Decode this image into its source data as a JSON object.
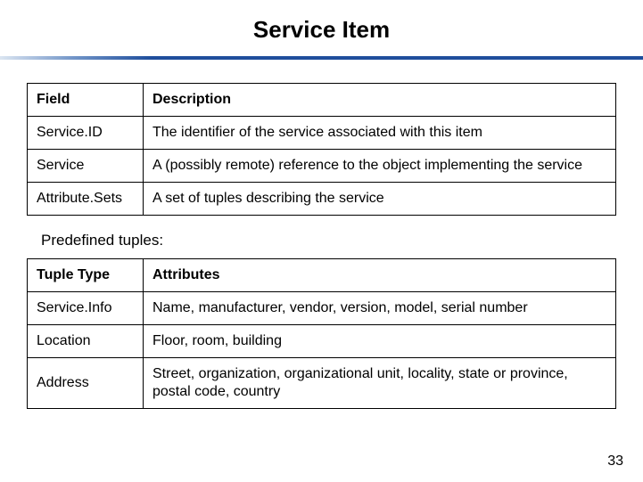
{
  "title": "Service Item",
  "fields_table": {
    "headers": {
      "c1": "Field",
      "c2": "Description"
    },
    "rows": [
      {
        "c1": "Service.ID",
        "c2": "The identifier of the service associated with this item"
      },
      {
        "c1": "Service",
        "c2": "A (possibly remote) reference to the object implementing the service"
      },
      {
        "c1": "Attribute.Sets",
        "c2": "A set of tuples describing the service"
      }
    ]
  },
  "predefined_label": "Predefined tuples:",
  "tuples_table": {
    "headers": {
      "c1": "Tuple Type",
      "c2": "Attributes"
    },
    "rows": [
      {
        "c1": "Service.Info",
        "c2": "Name, manufacturer, vendor, version, model, serial number"
      },
      {
        "c1": "Location",
        "c2": "Floor, room, building"
      },
      {
        "c1": "Address",
        "c2": "Street, organization, organizational unit, locality, state or province, postal code, country"
      }
    ]
  },
  "page_number": "33"
}
